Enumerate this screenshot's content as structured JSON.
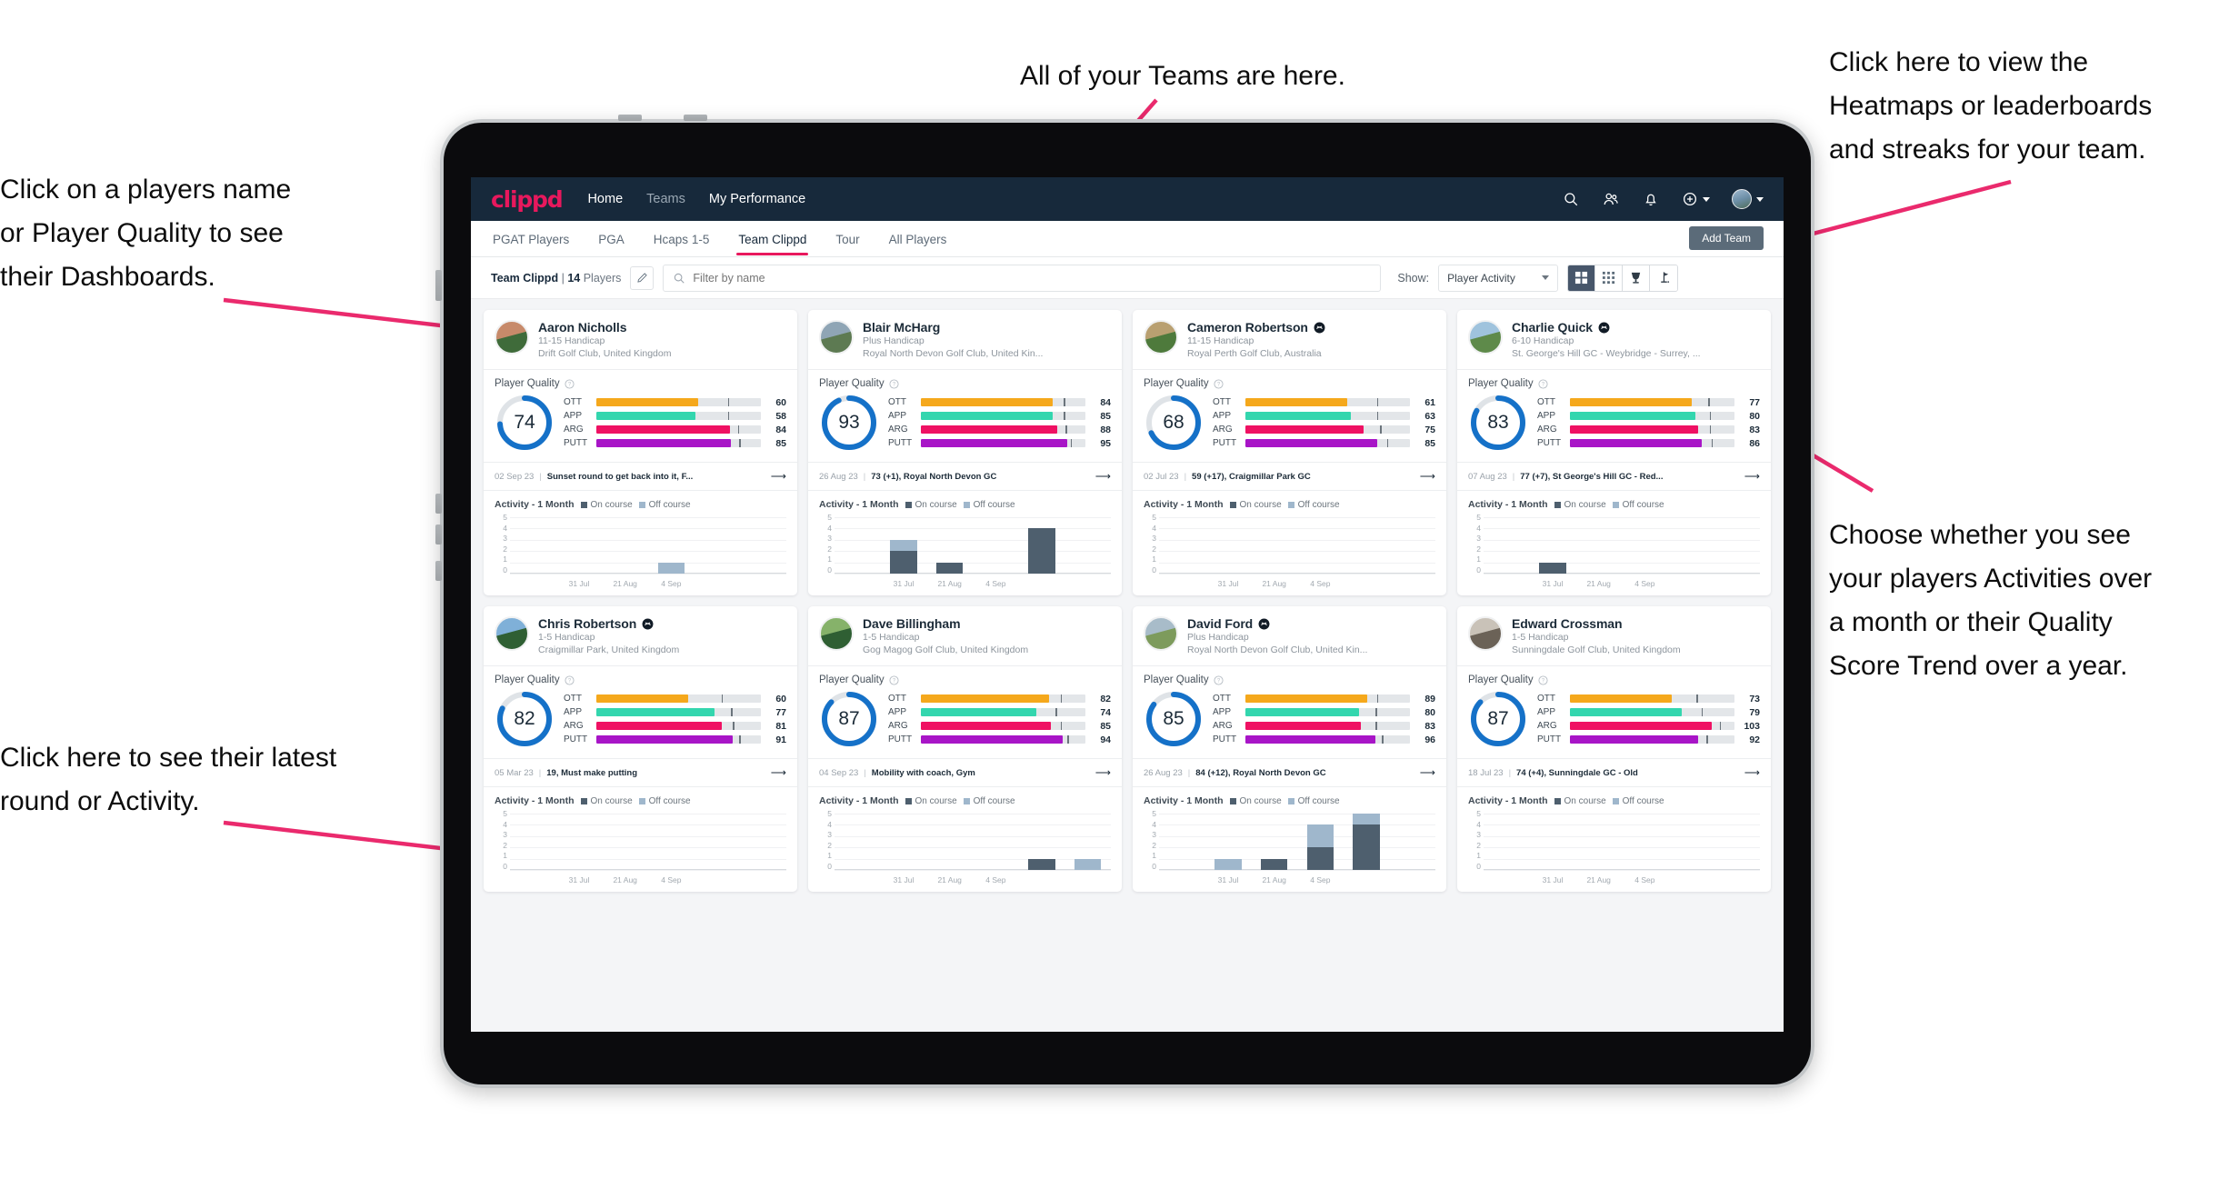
{
  "annotations": [
    {
      "id": "teams",
      "text": "All of your Teams are here."
    },
    {
      "id": "heatmaps",
      "text": "Click here to view the\nHeatmaps or leaderboards\nand streaks for your team."
    },
    {
      "id": "player-name",
      "text": "Click on a players name\nor Player Quality to see\ntheir Dashboards."
    },
    {
      "id": "activity-toggle",
      "text": "Choose whether you see\nyour players Activities over\na month or their Quality\nScore Trend over a year."
    },
    {
      "id": "latest-round",
      "text": "Click here to see their latest\nround or Activity."
    }
  ],
  "colors": {
    "brand_pink": "#e8185d",
    "nav_bg": "#17293b",
    "ott": "#f5a81c",
    "app": "#33d6ae",
    "arg": "#ef1163",
    "putt": "#a815c7",
    "donut": "#1571c8",
    "on_course": "#4e5f6e",
    "off_course": "#9fb7cc"
  },
  "topnav": {
    "logo": "clippd",
    "links": [
      {
        "label": "Home",
        "active": true
      },
      {
        "label": "Teams",
        "active": false
      },
      {
        "label": "My Performance",
        "active": true
      }
    ],
    "icons": [
      {
        "name": "search-icon"
      },
      {
        "name": "people-icon"
      },
      {
        "name": "bell-icon"
      },
      {
        "name": "plus-circle-icon"
      },
      {
        "name": "avatar"
      }
    ]
  },
  "subtabs": {
    "items": [
      {
        "label": "PGAT Players",
        "active": false
      },
      {
        "label": "PGA",
        "active": false
      },
      {
        "label": "Hcaps 1-5",
        "active": false
      },
      {
        "label": "Team Clippd",
        "active": true
      },
      {
        "label": "Tour",
        "active": false
      },
      {
        "label": "All Players",
        "active": false
      }
    ],
    "add_team_label": "Add Team"
  },
  "filterbar": {
    "team_name": "Team Clippd",
    "separator": "|",
    "player_count": "14",
    "players_word": "Players",
    "search_placeholder": "Filter by name",
    "search_value": "",
    "show_label": "Show:",
    "show_value": "Player Activity",
    "show_options": [
      "Player Activity",
      "Quality Score Trend"
    ],
    "view_buttons": [
      {
        "name": "grid-large-icon",
        "active": true
      },
      {
        "name": "grid-small-icon",
        "active": false
      },
      {
        "name": "trophy-icon",
        "active": false
      },
      {
        "name": "flag-icon",
        "active": false
      }
    ]
  },
  "chart_common": {
    "act_title": "Activity - 1 Month",
    "legend": [
      {
        "label": "On course",
        "color": "#4e5f6e"
      },
      {
        "label": "Off course",
        "color": "#9fb7cc"
      }
    ],
    "yticks": [
      "5",
      "4",
      "3",
      "2",
      "1",
      "0"
    ],
    "ymax": 5,
    "xticks": [
      "31 Jul",
      "21 Aug",
      "4 Sep"
    ],
    "slots": 6
  },
  "players": [
    {
      "name": "Aaron Nicholls",
      "verified": false,
      "handicap": "11-15 Handicap",
      "club": "Drift Golf Club, United Kingdom",
      "avatar_colors": [
        "#c78a6a",
        "#3f6b3a"
      ],
      "pq_title": "Player Quality",
      "quality": 74,
      "metrics": [
        {
          "label": "OTT",
          "value": 60,
          "fill": 62,
          "tick": 80,
          "color": "#f5a81c"
        },
        {
          "label": "APP",
          "value": 58,
          "fill": 60,
          "tick": 80,
          "color": "#33d6ae"
        },
        {
          "label": "ARG",
          "value": 84,
          "fill": 81,
          "tick": 86,
          "color": "#ef1163"
        },
        {
          "label": "PUTT",
          "value": 85,
          "fill": 82,
          "tick": 87,
          "color": "#a815c7"
        }
      ],
      "round": {
        "date": "02 Sep 23",
        "text": "Sunset round to get back into it, F..."
      },
      "chart_data": {
        "type": "bar",
        "title": "Activity - 1 Month",
        "xticks": [
          "31 Jul",
          "21 Aug",
          "4 Sep"
        ],
        "ylim": [
          0,
          5
        ],
        "series": [
          {
            "name": "On course",
            "values": [
              0,
              0,
              0,
              0,
              0,
              0
            ]
          },
          {
            "name": "Off course",
            "values": [
              0,
              0,
              0,
              1,
              0,
              0
            ]
          }
        ]
      }
    },
    {
      "name": "Blair McHarg",
      "verified": false,
      "handicap": "Plus Handicap",
      "club": "Royal North Devon Golf Club, United Kin...",
      "avatar_colors": [
        "#8fa5b5",
        "#5d7a52"
      ],
      "pq_title": "Player Quality",
      "quality": 93,
      "metrics": [
        {
          "label": "OTT",
          "value": 84,
          "fill": 80,
          "tick": 87,
          "color": "#f5a81c"
        },
        {
          "label": "APP",
          "value": 85,
          "fill": 80,
          "tick": 87,
          "color": "#33d6ae"
        },
        {
          "label": "ARG",
          "value": 88,
          "fill": 83,
          "tick": 88,
          "color": "#ef1163"
        },
        {
          "label": "PUTT",
          "value": 95,
          "fill": 89,
          "tick": 91,
          "color": "#a815c7"
        }
      ],
      "round": {
        "date": "26 Aug 23",
        "text": "73 (+1), Royal North Devon GC"
      },
      "chart_data": {
        "type": "bar",
        "title": "Activity - 1 Month",
        "xticks": [
          "31 Jul",
          "21 Aug",
          "4 Sep"
        ],
        "ylim": [
          0,
          5
        ],
        "series": [
          {
            "name": "On course",
            "values": [
              0,
              2,
              1,
              0,
              4,
              0
            ]
          },
          {
            "name": "Off course",
            "values": [
              0,
              1,
              0,
              0,
              0,
              0
            ]
          }
        ]
      }
    },
    {
      "name": "Cameron Robertson",
      "verified": true,
      "handicap": "11-15 Handicap",
      "club": "Royal Perth Golf Club, Australia",
      "avatar_colors": [
        "#b9a071",
        "#4e7a3c"
      ],
      "pq_title": "Player Quality",
      "quality": 68,
      "metrics": [
        {
          "label": "OTT",
          "value": 61,
          "fill": 62,
          "tick": 80,
          "color": "#f5a81c"
        },
        {
          "label": "APP",
          "value": 63,
          "fill": 64,
          "tick": 80,
          "color": "#33d6ae"
        },
        {
          "label": "ARG",
          "value": 75,
          "fill": 72,
          "tick": 82,
          "color": "#ef1163"
        },
        {
          "label": "PUTT",
          "value": 85,
          "fill": 80,
          "tick": 86,
          "color": "#a815c7"
        }
      ],
      "round": {
        "date": "02 Jul 23",
        "text": "59 (+17), Craigmillar Park GC"
      },
      "chart_data": {
        "type": "bar",
        "title": "Activity - 1 Month",
        "xticks": [
          "31 Jul",
          "21 Aug",
          "4 Sep"
        ],
        "ylim": [
          0,
          5
        ],
        "series": [
          {
            "name": "On course",
            "values": [
              0,
              0,
              0,
              0,
              0,
              0
            ]
          },
          {
            "name": "Off course",
            "values": [
              0,
              0,
              0,
              0,
              0,
              0
            ]
          }
        ]
      }
    },
    {
      "name": "Charlie Quick",
      "verified": true,
      "handicap": "6-10 Handicap",
      "club": "St. George's Hill GC - Weybridge - Surrey, ...",
      "avatar_colors": [
        "#9fc3dd",
        "#5e8a4a"
      ],
      "pq_title": "Player Quality",
      "quality": 83,
      "metrics": [
        {
          "label": "OTT",
          "value": 77,
          "fill": 74,
          "tick": 84,
          "color": "#f5a81c"
        },
        {
          "label": "APP",
          "value": 80,
          "fill": 76,
          "tick": 85,
          "color": "#33d6ae"
        },
        {
          "label": "ARG",
          "value": 83,
          "fill": 78,
          "tick": 85,
          "color": "#ef1163"
        },
        {
          "label": "PUTT",
          "value": 86,
          "fill": 80,
          "tick": 86,
          "color": "#a815c7"
        }
      ],
      "round": {
        "date": "07 Aug 23",
        "text": "77 (+7), St George's Hill GC - Red..."
      },
      "chart_data": {
        "type": "bar",
        "title": "Activity - 1 Month",
        "xticks": [
          "31 Jul",
          "21 Aug",
          "4 Sep"
        ],
        "ylim": [
          0,
          5
        ],
        "series": [
          {
            "name": "On course",
            "values": [
              0,
              1,
              0,
              0,
              0,
              0
            ]
          },
          {
            "name": "Off course",
            "values": [
              0,
              0,
              0,
              0,
              0,
              0
            ]
          }
        ]
      }
    },
    {
      "name": "Chris Robertson",
      "verified": true,
      "handicap": "1-5 Handicap",
      "club": "Craigmillar Park, United Kingdom",
      "avatar_colors": [
        "#7fb0d8",
        "#2f5f33"
      ],
      "pq_title": "Player Quality",
      "quality": 82,
      "metrics": [
        {
          "label": "OTT",
          "value": 60,
          "fill": 56,
          "tick": 76,
          "color": "#f5a81c"
        },
        {
          "label": "APP",
          "value": 77,
          "fill": 72,
          "tick": 82,
          "color": "#33d6ae"
        },
        {
          "label": "ARG",
          "value": 81,
          "fill": 76,
          "tick": 83,
          "color": "#ef1163"
        },
        {
          "label": "PUTT",
          "value": 91,
          "fill": 83,
          "tick": 87,
          "color": "#a815c7"
        }
      ],
      "round": {
        "date": "05 Mar 23",
        "text": "19, Must make putting"
      },
      "chart_data": {
        "type": "bar",
        "title": "Activity - 1 Month",
        "xticks": [
          "31 Jul",
          "21 Aug",
          "4 Sep"
        ],
        "ylim": [
          0,
          5
        ],
        "series": [
          {
            "name": "On course",
            "values": [
              0,
              0,
              0,
              0,
              0,
              0
            ]
          },
          {
            "name": "Off course",
            "values": [
              0,
              0,
              0,
              0,
              0,
              0
            ]
          }
        ]
      }
    },
    {
      "name": "Dave Billingham",
      "verified": false,
      "handicap": "1-5 Handicap",
      "club": "Gog Magog Golf Club, United Kingdom",
      "avatar_colors": [
        "#86b26a",
        "#2f5f33"
      ],
      "pq_title": "Player Quality",
      "quality": 87,
      "metrics": [
        {
          "label": "OTT",
          "value": 82,
          "fill": 78,
          "tick": 85,
          "color": "#f5a81c"
        },
        {
          "label": "APP",
          "value": 74,
          "fill": 70,
          "tick": 82,
          "color": "#33d6ae"
        },
        {
          "label": "ARG",
          "value": 85,
          "fill": 79,
          "tick": 85,
          "color": "#ef1163"
        },
        {
          "label": "PUTT",
          "value": 94,
          "fill": 86,
          "tick": 89,
          "color": "#a815c7"
        }
      ],
      "round": {
        "date": "04 Sep 23",
        "text": "Mobility with coach, Gym"
      },
      "chart_data": {
        "type": "bar",
        "title": "Activity - 1 Month",
        "xticks": [
          "31 Jul",
          "21 Aug",
          "4 Sep"
        ],
        "ylim": [
          0,
          5
        ],
        "series": [
          {
            "name": "On course",
            "values": [
              0,
              0,
              0,
              0,
              1,
              0
            ]
          },
          {
            "name": "Off course",
            "values": [
              0,
              0,
              0,
              0,
              0,
              1
            ]
          }
        ]
      }
    },
    {
      "name": "David Ford",
      "verified": true,
      "handicap": "Plus Handicap",
      "club": "Royal North Devon Golf Club, United Kin...",
      "avatar_colors": [
        "#a8bcc9",
        "#7d9b5c"
      ],
      "pq_title": "Player Quality",
      "quality": 85,
      "metrics": [
        {
          "label": "OTT",
          "value": 89,
          "fill": 74,
          "tick": 80,
          "color": "#f5a81c"
        },
        {
          "label": "APP",
          "value": 80,
          "fill": 69,
          "tick": 79,
          "color": "#33d6ae"
        },
        {
          "label": "ARG",
          "value": 83,
          "fill": 70,
          "tick": 79,
          "color": "#ef1163"
        },
        {
          "label": "PUTT",
          "value": 96,
          "fill": 79,
          "tick": 83,
          "color": "#a815c7"
        }
      ],
      "round": {
        "date": "26 Aug 23",
        "text": "84 (+12), Royal North Devon GC"
      },
      "chart_data": {
        "type": "bar",
        "title": "Activity - 1 Month",
        "xticks": [
          "31 Jul",
          "21 Aug",
          "4 Sep"
        ],
        "ylim": [
          0,
          5
        ],
        "series": [
          {
            "name": "On course",
            "values": [
              0,
              0,
              1,
              2,
              4,
              0
            ]
          },
          {
            "name": "Off course",
            "values": [
              0,
              1,
              0,
              2,
              1,
              0
            ]
          }
        ]
      }
    },
    {
      "name": "Edward Crossman",
      "verified": false,
      "handicap": "1-5 Handicap",
      "club": "Sunningdale Golf Club, United Kingdom",
      "avatar_colors": [
        "#c9c2b8",
        "#6b6257"
      ],
      "pq_title": "Player Quality",
      "quality": 87,
      "metrics": [
        {
          "label": "OTT",
          "value": 73,
          "fill": 62,
          "tick": 77,
          "color": "#f5a81c"
        },
        {
          "label": "APP",
          "value": 79,
          "fill": 68,
          "tick": 80,
          "color": "#33d6ae"
        },
        {
          "label": "ARG",
          "value": 103,
          "fill": 86,
          "tick": 91,
          "color": "#ef1163"
        },
        {
          "label": "PUTT",
          "value": 92,
          "fill": 78,
          "tick": 83,
          "color": "#a815c7"
        }
      ],
      "round": {
        "date": "18 Jul 23",
        "text": "74 (+4), Sunningdale GC - Old"
      },
      "chart_data": {
        "type": "bar",
        "title": "Activity - 1 Month",
        "xticks": [
          "31 Jul",
          "21 Aug",
          "4 Sep"
        ],
        "ylim": [
          0,
          5
        ],
        "series": [
          {
            "name": "On course",
            "values": [
              0,
              0,
              0,
              0,
              0,
              0
            ]
          },
          {
            "name": "Off course",
            "values": [
              0,
              0,
              0,
              0,
              0,
              0
            ]
          }
        ]
      }
    }
  ]
}
